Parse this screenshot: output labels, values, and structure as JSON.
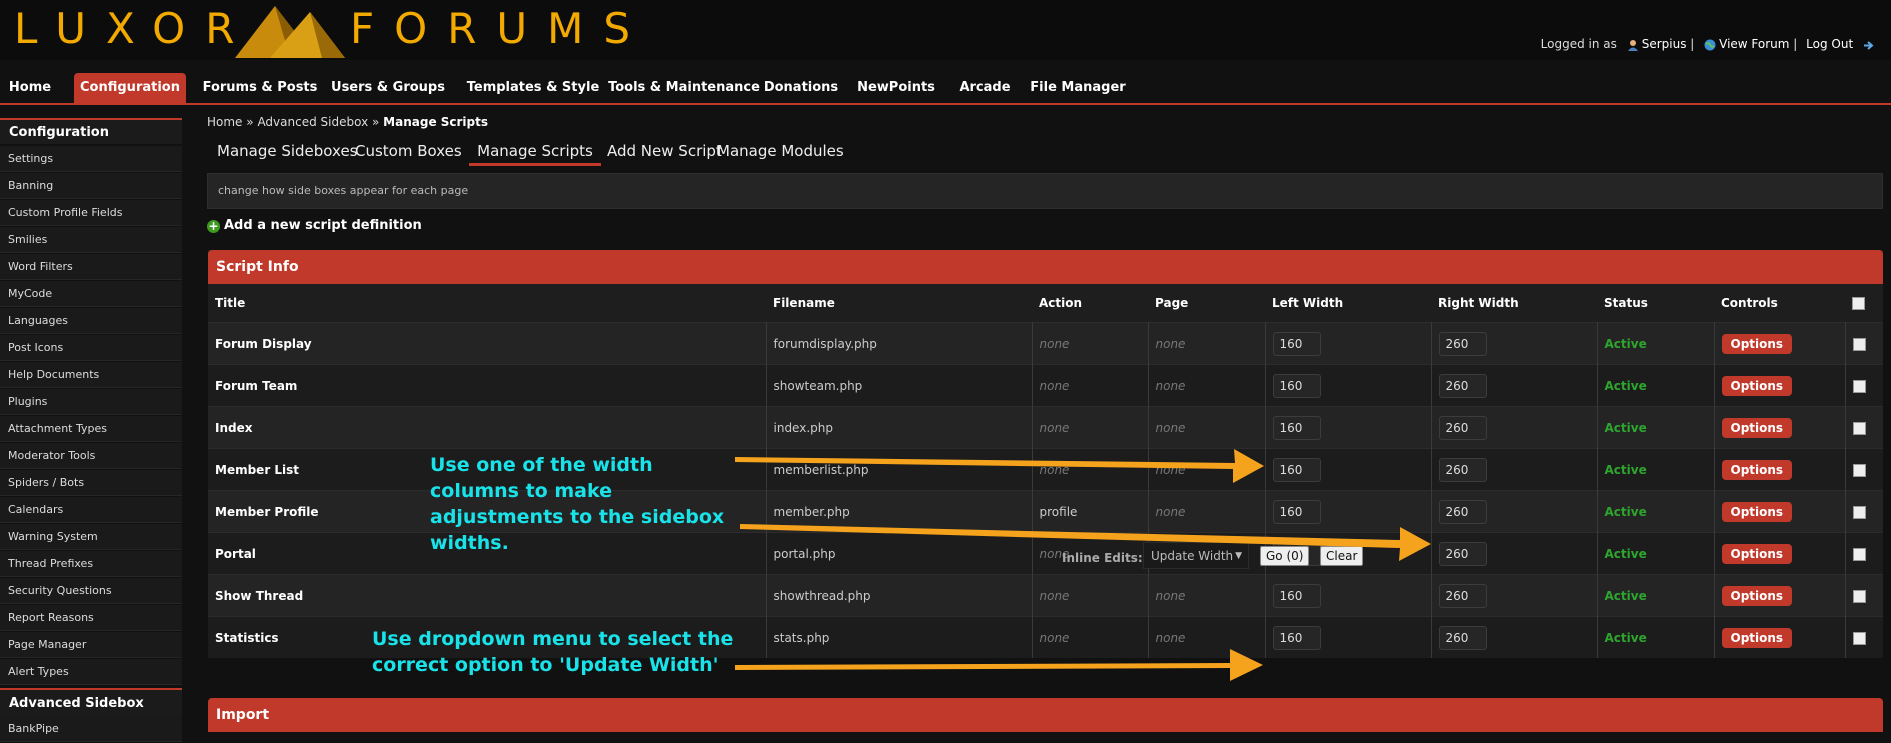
{
  "header": {
    "logo_left": "LUXOR",
    "logo_right": "FORUMS",
    "user": {
      "logged_in_as": "Logged in as",
      "username": "Serpius",
      "view_forum": "View Forum",
      "log_out": "Log Out"
    }
  },
  "topnav": {
    "items": [
      "Home",
      "Configuration",
      "Forums & Posts",
      "Users & Groups",
      "Templates & Style",
      "Tools & Maintenance",
      "Donations",
      "NewPoints",
      "Arcade",
      "File Manager"
    ],
    "active": "Configuration"
  },
  "sidebar": {
    "section1_title": "Configuration",
    "items": [
      "Settings",
      "Banning",
      "Custom Profile Fields",
      "Smilies",
      "Word Filters",
      "MyCode",
      "Languages",
      "Post Icons",
      "Help Documents",
      "Plugins",
      "Attachment Types",
      "Moderator Tools",
      "Spiders / Bots",
      "Calendars",
      "Warning System",
      "Thread Prefixes",
      "Security Questions",
      "Report Reasons",
      "Page Manager",
      "Alert Types"
    ],
    "section2_title": "Advanced Sidebox",
    "section2_items": [
      "BankPipe"
    ]
  },
  "breadcrumb": {
    "home": "Home",
    "sep": "»",
    "parent": "Advanced Sidebox",
    "current": "Manage Scripts"
  },
  "subtabs": [
    "Manage Sideboxes",
    "Custom Boxes",
    "Manage Scripts",
    "Add New Script",
    "Manage Modules"
  ],
  "description": "change how side boxes appear for each page",
  "add_link": "Add a new script definition",
  "script_table": {
    "title": "Script Info",
    "headers": [
      "Title",
      "Filename",
      "Action",
      "Page",
      "Left Width",
      "Right Width",
      "Status",
      "Controls"
    ],
    "rows": [
      {
        "title": "Forum Display",
        "filename": "forumdisplay.php",
        "action": "none",
        "page": "none",
        "left": "160",
        "right": "260",
        "status": "Active",
        "control": "Options"
      },
      {
        "title": "Forum Team",
        "filename": "showteam.php",
        "action": "none",
        "page": "none",
        "left": "160",
        "right": "260",
        "status": "Active",
        "control": "Options"
      },
      {
        "title": "Index",
        "filename": "index.php",
        "action": "none",
        "page": "none",
        "left": "160",
        "right": "260",
        "status": "Active",
        "control": "Options"
      },
      {
        "title": "Member List",
        "filename": "memberlist.php",
        "action": "none",
        "page": "none",
        "left": "160",
        "right": "260",
        "status": "Active",
        "control": "Options"
      },
      {
        "title": "Member Profile",
        "filename": "member.php",
        "action": "profile",
        "page": "none",
        "left": "160",
        "right": "260",
        "status": "Active",
        "control": "Options"
      },
      {
        "title": "Portal",
        "filename": "portal.php",
        "action": "none",
        "page": "none",
        "left": "160",
        "right": "260",
        "status": "Active",
        "control": "Options"
      },
      {
        "title": "Show Thread",
        "filename": "showthread.php",
        "action": "none",
        "page": "none",
        "left": "160",
        "right": "260",
        "status": "Active",
        "control": "Options"
      },
      {
        "title": "Statistics",
        "filename": "stats.php",
        "action": "none",
        "page": "none",
        "left": "160",
        "right": "260",
        "status": "Active",
        "control": "Options"
      }
    ],
    "inline_edits": {
      "label": "Inline Edits:",
      "selected": "Update Width",
      "go": "Go (0)",
      "clear": "Clear"
    }
  },
  "import_title": "Import",
  "annotations": {
    "width_note": [
      "Use one of the width",
      "columns to make",
      "adjustments to the sidebox",
      "widths."
    ],
    "dropdown_note": [
      "Use dropdown menu to select the",
      "correct option to 'Update Width'"
    ]
  },
  "colors": {
    "accent": "#c0392b",
    "logo": "#f2a900",
    "status_active": "#2ea52e",
    "annotation_text": "#19e2e9",
    "annotation_arrow": "#f5a21c"
  }
}
